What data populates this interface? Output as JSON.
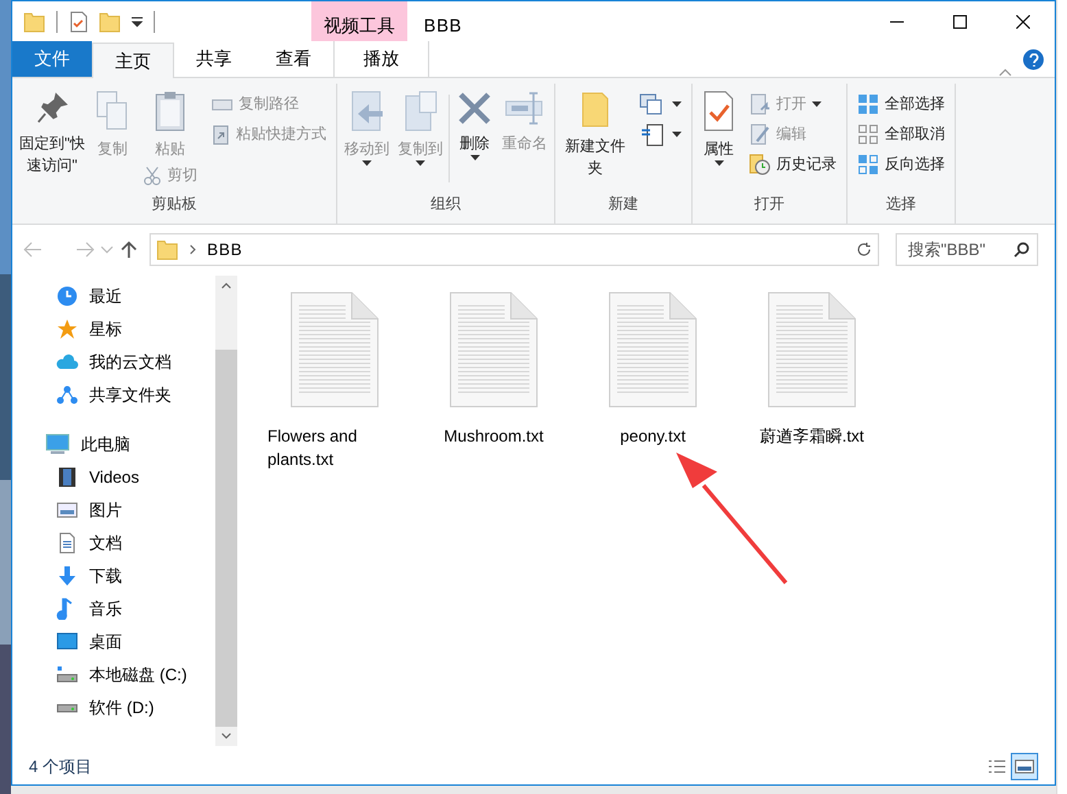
{
  "window": {
    "title": "BBB"
  },
  "file_menu": "文件",
  "tabs": [
    {
      "label": "主页",
      "selected": true
    },
    {
      "label": "共享",
      "selected": false
    },
    {
      "label": "查看",
      "selected": false
    }
  ],
  "contextual_group": {
    "label": "视频工具",
    "tabs": [
      {
        "label": "播放",
        "selected": false
      }
    ]
  },
  "ribbon_groups": [
    {
      "label": "剪贴板",
      "commands": [
        {
          "kind": "large",
          "label": "固定到\"快速访问\"",
          "disabled": false
        },
        {
          "kind": "large",
          "label": "复制",
          "disabled": true
        },
        {
          "kind": "large",
          "label": "粘贴",
          "disabled": true
        },
        {
          "kind": "under",
          "label": "剪切",
          "disabled": true
        },
        {
          "kind": "small",
          "label": "复制路径",
          "disabled": true
        },
        {
          "kind": "small",
          "label": "粘贴快捷方式",
          "disabled": true
        }
      ]
    },
    {
      "label": "组织",
      "commands": [
        {
          "kind": "large",
          "label": "移动到",
          "disabled": true,
          "dropdown": true
        },
        {
          "kind": "large",
          "label": "复制到",
          "disabled": true,
          "dropdown": true
        },
        {
          "kind": "large",
          "label": "删除",
          "disabled": false,
          "dropdown": true
        },
        {
          "kind": "large",
          "label": "重命名",
          "disabled": true
        }
      ]
    },
    {
      "label": "新建",
      "commands": [
        {
          "kind": "large",
          "label": "新建文件夹",
          "disabled": false
        },
        {
          "kind": "small",
          "disabled": false,
          "dropdown": true
        },
        {
          "kind": "small",
          "disabled": false,
          "dropdown": true
        }
      ]
    },
    {
      "label": "打开",
      "commands": [
        {
          "kind": "large",
          "label": "属性",
          "disabled": false,
          "dropdown": true
        },
        {
          "kind": "small",
          "label": "打开",
          "disabled": true,
          "dropdown": true
        },
        {
          "kind": "small",
          "label": "编辑",
          "disabled": true
        },
        {
          "kind": "small",
          "label": "历史记录",
          "disabled": false
        }
      ]
    },
    {
      "label": "选择",
      "commands": [
        {
          "kind": "small",
          "label": "全部选择",
          "disabled": false
        },
        {
          "kind": "small",
          "label": "全部取消",
          "disabled": false
        },
        {
          "kind": "small",
          "label": "反向选择",
          "disabled": false
        }
      ]
    }
  ],
  "address": {
    "path": [
      "BBB"
    ],
    "search_placeholder": "搜索\"BBB\""
  },
  "navigation": {
    "quick_items": [
      {
        "label": "最近"
      },
      {
        "label": "星标"
      },
      {
        "label": "我的云文档"
      },
      {
        "label": "共享文件夹"
      }
    ],
    "this_pc": {
      "label": "此电脑",
      "children": [
        {
          "label": "Videos"
        },
        {
          "label": "图片"
        },
        {
          "label": "文档"
        },
        {
          "label": "下载"
        },
        {
          "label": "音乐"
        },
        {
          "label": "桌面"
        },
        {
          "label": "本地磁盘 (C:)"
        },
        {
          "label": "软件 (D:)"
        }
      ]
    }
  },
  "files": [
    {
      "name": "Flowers and plants.txt"
    },
    {
      "name": "Mushroom.txt"
    },
    {
      "name": "peony.txt"
    },
    {
      "name": "蔚遒斈霜瞬.txt"
    }
  ],
  "status_bar": {
    "count": "4 个项目",
    "views": [
      {
        "selected": false
      },
      {
        "selected": true
      }
    ]
  }
}
